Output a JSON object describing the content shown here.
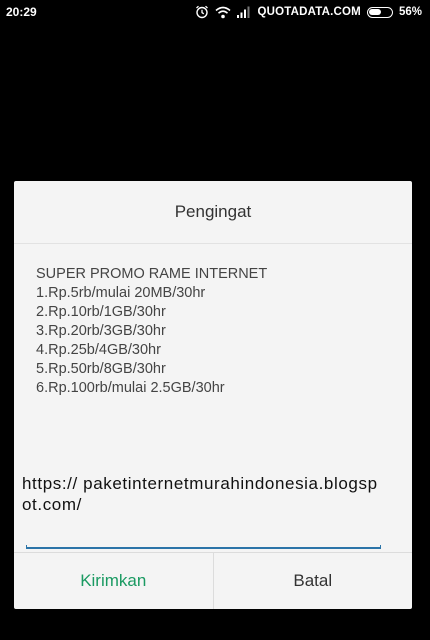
{
  "status_bar": {
    "time": "20:29",
    "carrier": "QUOTADATA.COM",
    "battery_percent_label": "56%",
    "battery_level": 0.56,
    "icons": [
      "alarm-icon",
      "wifi-icon",
      "signal-icon",
      "battery-icon"
    ]
  },
  "dialog": {
    "title": "Pengingat",
    "message_lines": [
      "SUPER PROMO RAME INTERNET",
      "1.Rp.5rb/mulai 20MB/30hr",
      "2.Rp.10rb/1GB/30hr",
      "3.Rp.20rb/3GB/30hr",
      "4.Rp.25b/4GB/30hr",
      "5.Rp.50rb/8GB/30hr",
      "6.Rp.100rb/mulai 2.5GB/30hr"
    ],
    "input_value": "https:// paketinternetmurahindonesia.blogspot.com/",
    "send_label": "Kirimkan",
    "cancel_label": "Batal"
  },
  "colors": {
    "background": "#000000",
    "dialog_bg": "#f4f4f4",
    "send_button": "#1a9a62",
    "input_underline": "#2b74a8"
  }
}
